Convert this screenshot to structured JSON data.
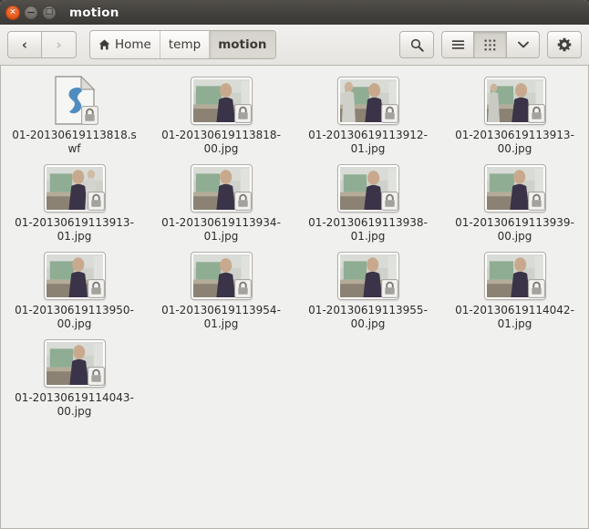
{
  "window": {
    "title": "motion",
    "controls": {
      "close_label": "×",
      "minimize_label": "−",
      "maximize_label": "□",
      "close_name": "close",
      "minimize_name": "minimize",
      "maximize_name": "maximize"
    },
    "accent_color": "#e8581f",
    "titlebar_color": "#464440"
  },
  "toolbar": {
    "back_label": "‹",
    "forward_label": "›",
    "back_enabled": true,
    "forward_enabled": false,
    "search_icon": "search-icon",
    "list_view_icon": "list-view-icon",
    "grid_view_icon": "grid-view-icon",
    "view_dropdown_icon": "chevron-down-icon",
    "settings_icon": "gear-icon",
    "active_view": "grid"
  },
  "breadcrumb": {
    "items": [
      {
        "label": "Home",
        "icon": "home-icon",
        "active": false
      },
      {
        "label": "temp",
        "icon": "",
        "active": false
      },
      {
        "label": "motion",
        "icon": "",
        "active": true
      }
    ]
  },
  "files": {
    "count": 13,
    "items": [
      {
        "name": "01-20130619113818.swf",
        "type": "swf",
        "locked": true
      },
      {
        "name": "01-20130619113818-00.jpg",
        "type": "image",
        "locked": true
      },
      {
        "name": "01-20130619113912-01.jpg",
        "type": "image",
        "locked": true
      },
      {
        "name": "01-20130619113913-00.jpg",
        "type": "image",
        "locked": true
      },
      {
        "name": "01-20130619113913-01.jpg",
        "type": "image",
        "locked": true
      },
      {
        "name": "01-20130619113934-01.jpg",
        "type": "image",
        "locked": true
      },
      {
        "name": "01-20130619113938-01.jpg",
        "type": "image",
        "locked": true
      },
      {
        "name": "01-20130619113939-00.jpg",
        "type": "image",
        "locked": true
      },
      {
        "name": "01-20130619113950-00.jpg",
        "type": "image",
        "locked": true
      },
      {
        "name": "01-20130619113954-01.jpg",
        "type": "image",
        "locked": true
      },
      {
        "name": "01-20130619113955-00.jpg",
        "type": "image",
        "locked": true
      },
      {
        "name": "01-20130619114042-01.jpg",
        "type": "image",
        "locked": true
      },
      {
        "name": "01-20130619114043-00.jpg",
        "type": "image",
        "locked": true
      }
    ]
  }
}
